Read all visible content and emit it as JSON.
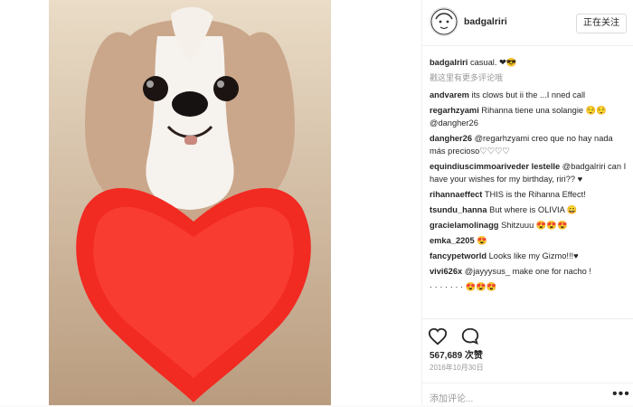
{
  "post": {
    "author": "badgalriri",
    "follow_label": "正在关注",
    "caption_user": "badgalriri",
    "caption_text": "casual. ❤😎",
    "more_comments_label": "戳这里有更多评论哦",
    "likes": "567,689 次赞",
    "date": "2016年10月30日",
    "add_comment_placeholder": "添加评论...",
    "more_icon": "•••"
  },
  "comments": [
    {
      "user": "andvarem",
      "text": "its clows but ii the ...I nned call"
    },
    {
      "user": "regarhzyami",
      "text": "Rihanna tiene una solangie 😌😌 @dangher26"
    },
    {
      "user": "dangher26",
      "text": "@regarhzyami creo que no hay nada más precioso♡♡♡♡"
    },
    {
      "user": "equindiuscimmoariveder lestelle",
      "text": "@badgalriri can I have your wishes for my birthday, riri?? ♥"
    },
    {
      "user": "rihannaeffect",
      "text": "THIS is the Rihanna Effect!"
    },
    {
      "user": "tsundu_hanna",
      "text": "But where is OLIVIA 😄"
    },
    {
      "user": "gracielamolinagg",
      "text": "Shitzuuu 😍😍😍"
    },
    {
      "user": "emka_2205",
      "text": "😍"
    },
    {
      "user": "fancypetworld",
      "text": "Looks like my Gizmo!!!♥"
    },
    {
      "user": "vivi626x",
      "text": "@jayyysus_ make one for nacho !"
    },
    {
      "user": "",
      "text": "· · · · · · · 😍😍😍"
    }
  ]
}
